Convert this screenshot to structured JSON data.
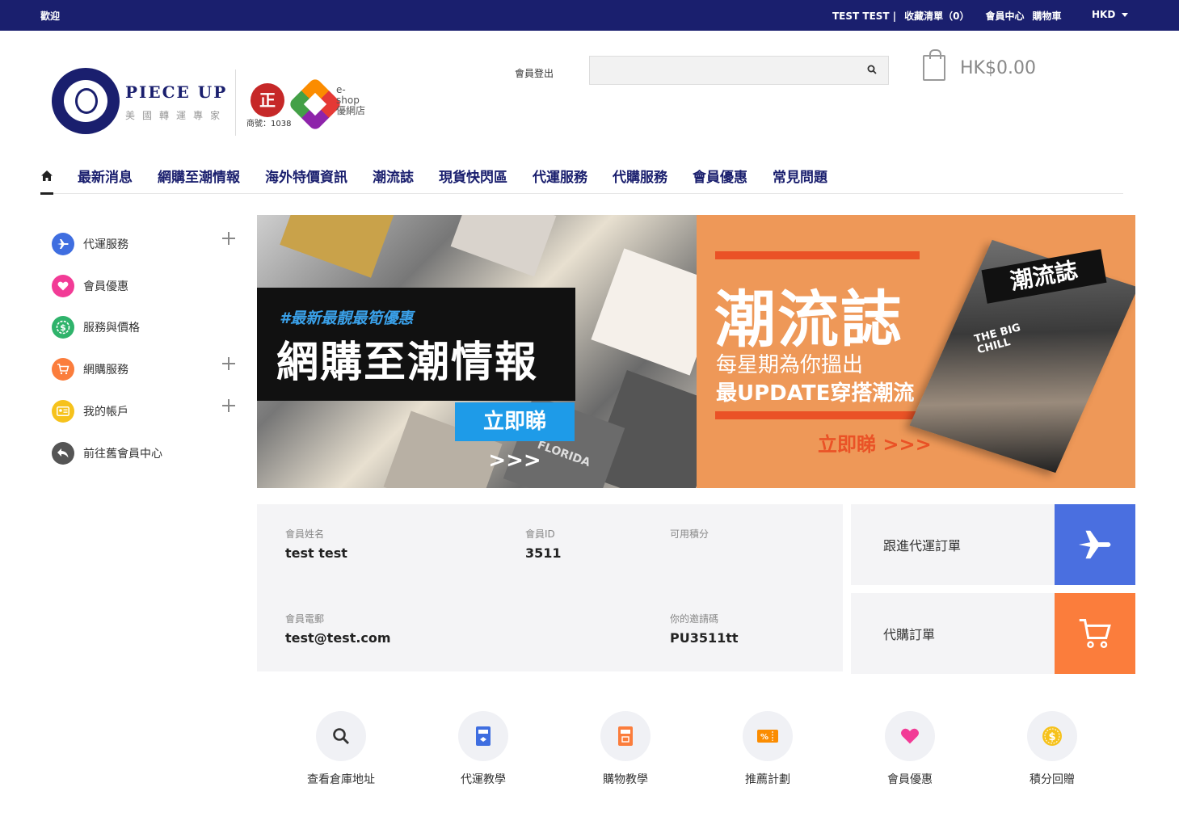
{
  "topbar": {
    "welcome": "歡迎",
    "user": "TEST TEST |",
    "wishlist": "收藏清單（0）",
    "member_center": "會員中心",
    "cart": "購物車",
    "currency": "HKD"
  },
  "header": {
    "logo_title": "PIECE UP",
    "logo_subtitle": "美國轉運專家",
    "badge_zheng": "正",
    "badge_number": "商號：1038",
    "badge_eshop": "e-shop 優網店",
    "logout": "會員登出",
    "search_placeholder": "",
    "cart_amount": "HK$0.00"
  },
  "nav": {
    "items": [
      "最新消息",
      "網購至潮情報",
      "海外特價資訊",
      "潮流誌",
      "現貨快閃區",
      "代運服務",
      "代購服務",
      "會員優惠",
      "常見問題"
    ]
  },
  "sidebar": {
    "items": [
      {
        "label": "代運服務",
        "color": "#3f6ee0",
        "icon": "plane-icon",
        "expandable": true
      },
      {
        "label": "會員優惠",
        "color": "#f23b96",
        "icon": "heart-icon",
        "expandable": false
      },
      {
        "label": "服務與價格",
        "color": "#2fb36b",
        "icon": "dollar-icon",
        "expandable": false
      },
      {
        "label": "網購服務",
        "color": "#fb7d3c",
        "icon": "cart-icon",
        "expandable": true
      },
      {
        "label": "我的帳戶",
        "color": "#f6c21c",
        "icon": "id-card-icon",
        "expandable": true
      },
      {
        "label": "前往舊會員中心",
        "color": "#555555",
        "icon": "back-arrow-icon",
        "expandable": false
      }
    ]
  },
  "banners": {
    "left": {
      "tag": "#最新最靚最筍優惠",
      "title": "網購至潮情報",
      "cta": "立即睇 >>>",
      "tile_text": "FLORIDA"
    },
    "right": {
      "title": "潮流誌",
      "line1": "每星期為你搵出",
      "line2": "最UPDATE穿搭潮流",
      "cta": "立即睇 >>>",
      "mag_title": "潮流誌",
      "mag_cover": "THE BIG CHILL"
    }
  },
  "member": {
    "name_label": "會員姓名",
    "name": "test test",
    "id_label": "會員ID",
    "id": "3511",
    "points_label": "可用積分",
    "points": "",
    "email_label": "會員電郵",
    "email": "test@test.com",
    "invite_label": "你的邀請碼",
    "invite": "PU3511tt"
  },
  "orders": [
    {
      "label": "跟進代運訂單",
      "color": "#4a6fe0",
      "icon": "plane-icon"
    },
    {
      "label": "代購訂單",
      "color": "#fb7d3c",
      "icon": "cart-icon"
    }
  ],
  "quick_links": [
    {
      "label": "查看倉庫地址",
      "icon": "search-icon"
    },
    {
      "label": "代運教學",
      "icon": "shipping-guide-icon"
    },
    {
      "label": "購物教學",
      "icon": "shopping-guide-icon"
    },
    {
      "label": "推薦計劃",
      "icon": "referral-ticket-icon"
    },
    {
      "label": "會員優惠",
      "icon": "heart-icon"
    },
    {
      "label": "積分回贈",
      "icon": "coin-icon"
    }
  ]
}
